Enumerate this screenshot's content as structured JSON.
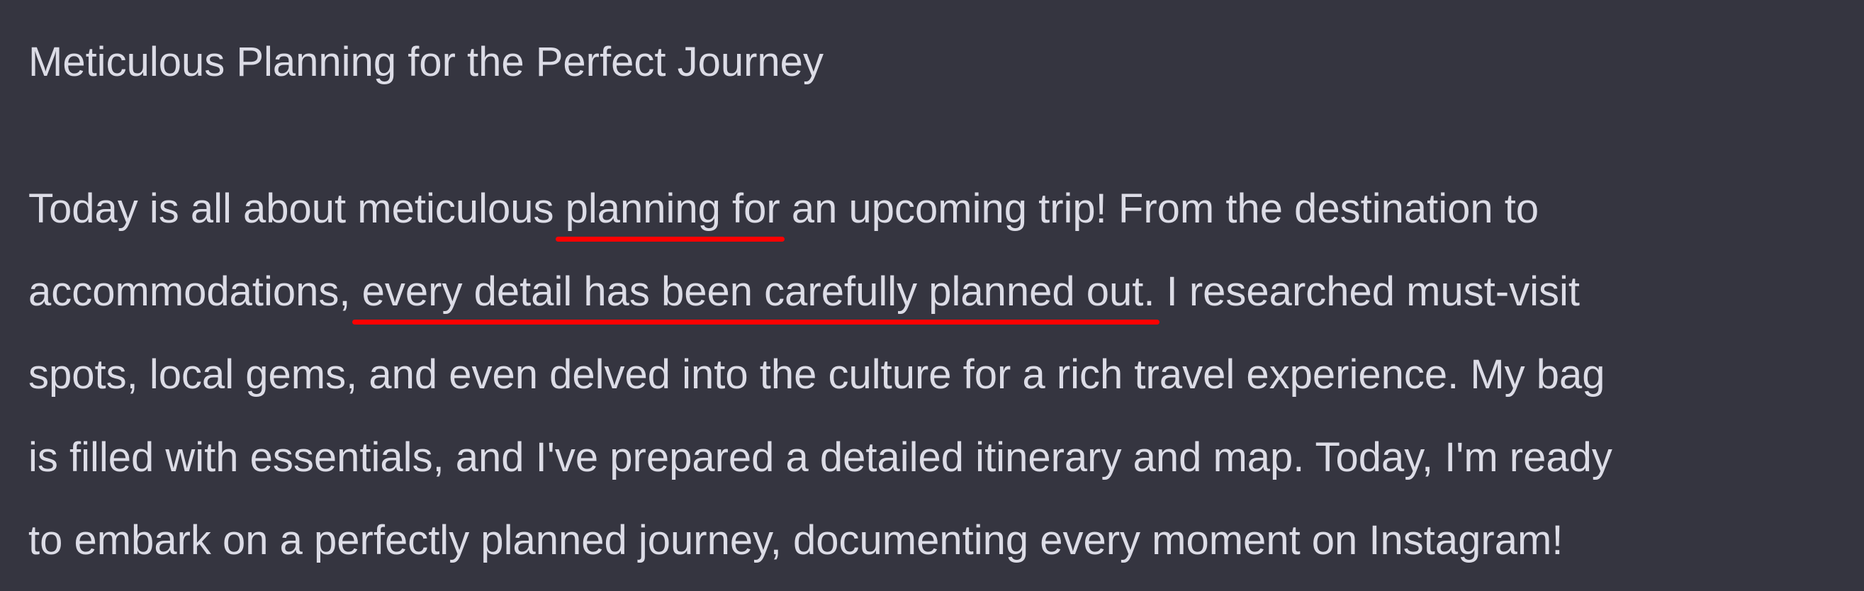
{
  "post": {
    "title": "Meticulous Planning for the Perfect Journey",
    "lines": [
      {
        "pre": "Today is all about meticulous ",
        "highlight": "planning for",
        "post": " an upcoming trip! From the destination to"
      },
      {
        "pre": "accommodations, ",
        "highlight": "every detail has been carefully planned out.",
        "post": " I researched must-visit"
      },
      {
        "text": "spots, local gems, and even delved into the culture for a rich travel experience. My bag"
      },
      {
        "text": "is filled with essentials, and I've prepared a detailed itinerary and map. Today, I'm ready"
      },
      {
        "text": "to embark on a perfectly planned journey, documenting every moment on Instagram!"
      }
    ]
  },
  "colors": {
    "background": "#353540",
    "text": "#dcdce6",
    "underline": "#ff0000"
  }
}
